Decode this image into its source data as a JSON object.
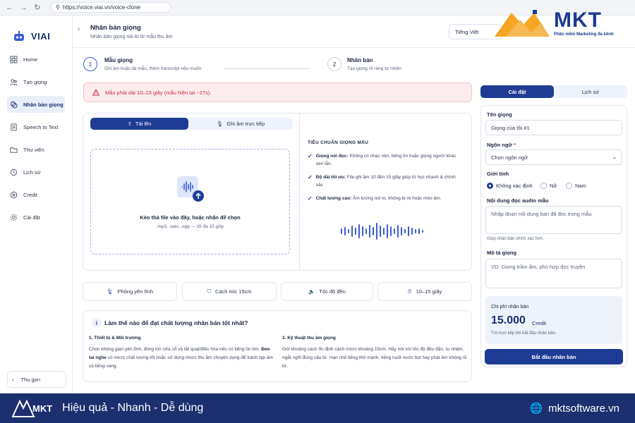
{
  "browser": {
    "url": "https://voice.viai.vn/voice-clone"
  },
  "sidebar": {
    "logo": "VIAI",
    "items": [
      {
        "label": "Home",
        "icon": "home-icon"
      },
      {
        "label": "Tạo giọng",
        "icon": "people-icon"
      },
      {
        "label": "Nhân bản giọng",
        "icon": "clone-icon"
      },
      {
        "label": "Speech to Text",
        "icon": "document-icon"
      },
      {
        "label": "Thư viện",
        "icon": "folder-icon"
      },
      {
        "label": "Lịch sử",
        "icon": "history-icon"
      },
      {
        "label": "Credit",
        "icon": "coin-icon"
      },
      {
        "label": "Cài đặt",
        "icon": "settings-icon"
      }
    ],
    "collapse_label": "Thu gọn"
  },
  "header": {
    "title": "Nhân bản giọng",
    "subtitle": "Nhân bản giọng nói AI từ mẫu thu âm",
    "language": "Tiếng Việt"
  },
  "steps": [
    {
      "number": "1",
      "title": "Mẫu giọng",
      "desc": "Ghi âm hoặc tải mẫu, thêm transcript nếu muốn"
    },
    {
      "number": "2",
      "title": "Nhân bản",
      "desc": "Tạo giọng rõ ràng tự nhiên"
    }
  ],
  "alert": "Mẫu phải dài 10–15 giây (mẫu hiện tại ~27s).",
  "upload": {
    "tab_upload": "Tải lên",
    "tab_record": "Ghi âm trực tiếp",
    "drop_title": "Kéo thả file vào đây, hoặc nhấn để chọn",
    "drop_sub": ".mp3, .wav, .ogg — tối đa 15 giây"
  },
  "standards": {
    "title": "TIÊU CHUẨN GIỌNG MẪU",
    "items": [
      {
        "bold": "Giọng nói đọc:",
        "text": " Không có nhạc nền, tiếng ồn hoặc giọng người khác xen lẫn."
      },
      {
        "bold": "Độ dài tối ưu:",
        "text": " File ghi âm 10 đến 15 giây giúp AI học nhanh & chính xác"
      },
      {
        "bold": "Chất lượng cao:",
        "text": " Âm lượng nói to, không bị rè hoặc méo âm."
      }
    ]
  },
  "chips": [
    {
      "label": "Phòng yên tĩnh",
      "icon": "mic-icon"
    },
    {
      "label": "Cách mic 15cm",
      "icon": "shield-icon"
    },
    {
      "label": "Tốc độ đều",
      "icon": "volume-icon"
    },
    {
      "label": "10–15 giây",
      "icon": "timer-icon"
    }
  ],
  "tips": {
    "title": "Làm thế nào để đạt chất lượng nhân bản tốt nhất?",
    "col1_title": "1. Thiết bị & Môi trường",
    "col1_text1": "Chọn không gian yên tĩnh, đóng kín cửa sổ và tắt quạt/điều hòa nếu có tiếng ồn lớn.",
    "col1_bold": "Đeo tai nghe",
    "col1_text2": " có micro chất lượng tốt hoặc sử dụng micro thu âm chuyên dụng để tránh tạp âm và tiếng vang.",
    "col2_title": "2. Kỹ thuật thu âm giọng",
    "col2_text": "Giữ khoảng cách ổn định cách micro khoảng 15cm. Hãy nói với tốc độ đều đặn, tự nhiên, ngắt nghỉ đúng câu từ. Hạn chế tiếng thở mạnh, tiếng nuốt nước bọt hay phát âm không rõ từ."
  },
  "right": {
    "tab_settings": "Cài đặt",
    "tab_history": "Lịch sử",
    "name_label": "Tên giọng",
    "name_value": "Giọng của tôi #1",
    "lang_label": "Ngôn ngữ",
    "lang_required": "*",
    "lang_placeholder": "Chọn ngôn ngữ",
    "gender_label": "Giới tính",
    "gender_options": [
      "Không xác định",
      "Nữ",
      "Nam"
    ],
    "transcript_label": "Nội dung đọc audio mẫu",
    "transcript_placeholder": "Nhập đoạn nội dung bạn đã đọc trong mẫu",
    "transcript_hint": "Giúp nhân bản chính xác hơn.",
    "desc_label": "Mô tả giọng",
    "desc_placeholder": "VD: Giọng trầm ấm, phù hợp đọc truyện",
    "cost_label": "Chi phí nhân bản",
    "cost_value": "15.000",
    "cost_unit": "Credit",
    "cost_note": "Trừ trực tiếp khi bắt đầu nhân bản.",
    "start_button": "Bắt đầu nhân bản"
  },
  "brand": {
    "name": "MKT",
    "tagline": "Phần mềm Marketing đa kênh"
  },
  "footer": {
    "logo": "MKT",
    "slogan": "Hiệu quả - Nhanh - Dễ dùng",
    "site": "mktsoftware.vn"
  },
  "colors": {
    "primary": "#1f3c94",
    "alert": "#c0303f",
    "footer": "#1c2f6e"
  }
}
